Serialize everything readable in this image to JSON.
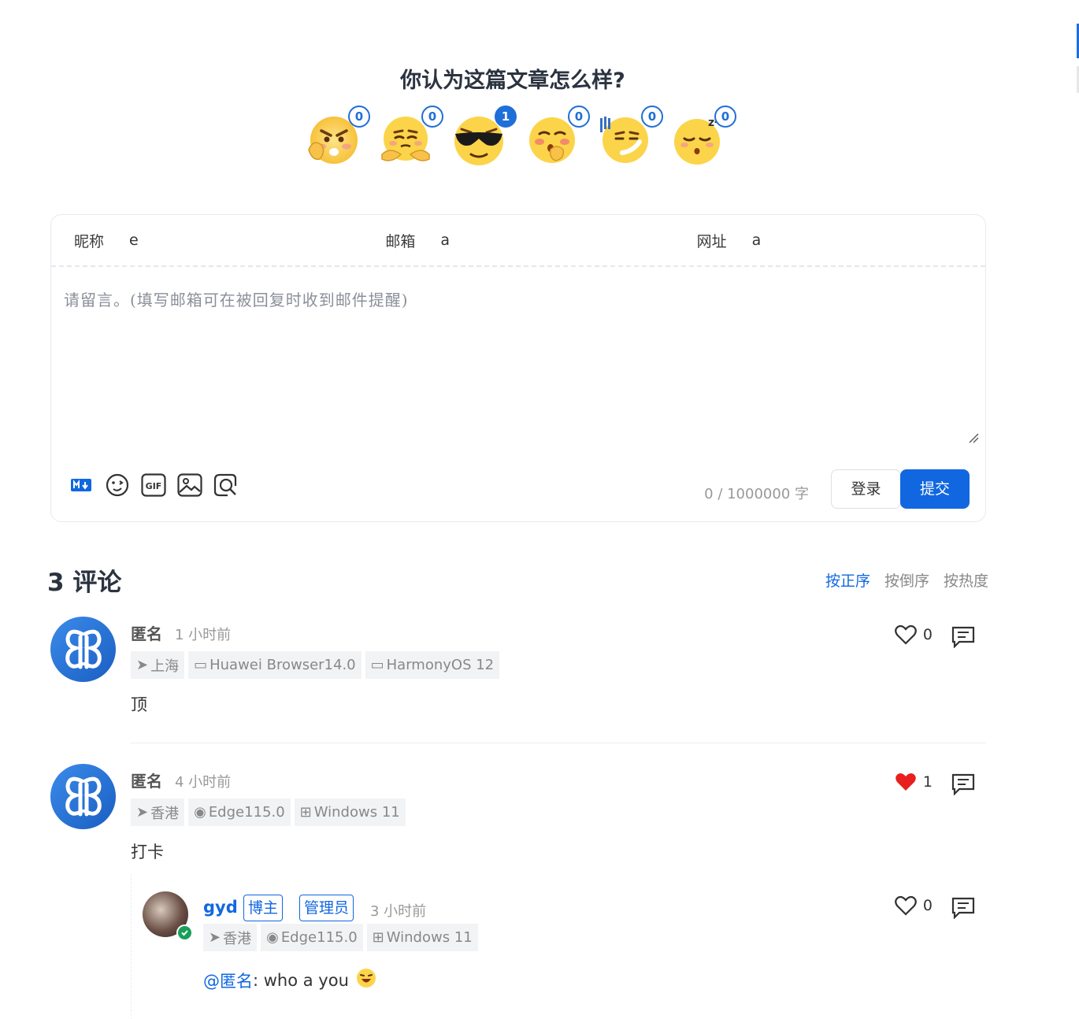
{
  "reaction_title": "你认为这篇文章怎么样?",
  "reactions": [
    {
      "icon": "angry-thinking-emoji-icon",
      "count": "0"
    },
    {
      "icon": "smug-arms-crossed-emoji-icon",
      "count": "0"
    },
    {
      "icon": "sunglasses-cool-emoji-icon",
      "count": "1"
    },
    {
      "icon": "shy-blushing-emoji-icon",
      "count": "0"
    },
    {
      "icon": "sweating-smirk-emoji-icon",
      "count": "0"
    },
    {
      "icon": "sleepy-zzz-emoji-icon",
      "count": "0"
    }
  ],
  "form": {
    "nick_label": "昵称",
    "nick_value": "e",
    "mail_label": "邮箱",
    "mail_value": "a",
    "link_label": "网址",
    "link_value": "a",
    "placeholder": "请留言。(填写邮箱可在被回复时收到邮件提醒)",
    "word_count": "0  /  1000000  字",
    "login_label": "登录",
    "submit_label": "提交"
  },
  "toolbar": {
    "markdown_icon": "markdown-icon",
    "emoji_icon": "emoji-icon",
    "gif_icon": "gif-icon",
    "image_icon": "image-icon",
    "preview_icon": "preview-icon"
  },
  "comments_header": "3 评论",
  "sort": {
    "asc": "按正序",
    "desc": "按倒序",
    "hot": "按热度"
  },
  "comments": [
    {
      "name": "匿名",
      "time": "1 小时前",
      "location": "上海",
      "browser": "Huawei Browser14.0",
      "os": "HarmonyOS 12",
      "text": "顶",
      "likes": "0",
      "liked": false
    },
    {
      "name": "匿名",
      "time": "4 小时前",
      "location": "香港",
      "browser": "Edge115.0",
      "os": "Windows 11",
      "text": "打卡",
      "likes": "1",
      "liked": true
    }
  ],
  "reply": {
    "name": "gyd",
    "badge_owner": "博主",
    "badge_admin": "管理员",
    "time": "3 小时前",
    "location": "香港",
    "browser": "Edge115.0",
    "os": "Windows 11",
    "mention": "@匿名",
    "text": ": who a you",
    "likes": "0"
  },
  "colors": {
    "accent": "#1167e0",
    "like_red": "#e91e1e"
  }
}
